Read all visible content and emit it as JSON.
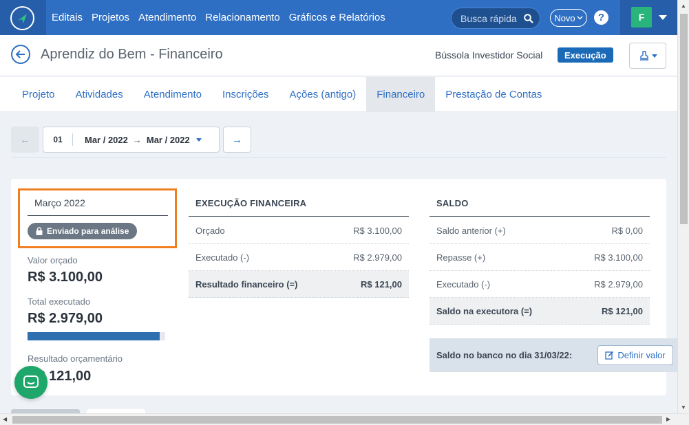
{
  "nav": {
    "items": [
      "Editais",
      "Projetos",
      "Atendimento",
      "Relacionamento",
      "Gráficos e Relatórios"
    ],
    "search_placeholder": "Busca rápida",
    "novo_label": "Novo",
    "help_label": "?",
    "avatar_initial": "F"
  },
  "header": {
    "title": "Aprendiz do Bem - Financeiro",
    "organization": "Bússola Investidor Social",
    "status_badge": "Execução"
  },
  "tabs": [
    {
      "label": "Projeto",
      "active": false
    },
    {
      "label": "Atividades",
      "active": false
    },
    {
      "label": "Atendimento",
      "active": false
    },
    {
      "label": "Inscrições",
      "active": false
    },
    {
      "label": "Ações (antigo)",
      "active": false
    },
    {
      "label": "Financeiro",
      "active": true
    },
    {
      "label": "Prestação de Contas",
      "active": false
    }
  ],
  "period": {
    "number": "01",
    "from": "Mar / 2022",
    "to": "Mar / 2022"
  },
  "summary": {
    "month": "Março 2022",
    "status": "Enviado para análise",
    "budget_label": "Valor orçado",
    "budget_value": "R$ 3.100,00",
    "executed_label": "Total executado",
    "executed_value": "R$ 2.979,00",
    "executed_progress": 0.961,
    "result_label": "Resultado orçamentário",
    "result_value": "R$ 121,00"
  },
  "execucao": {
    "title": "EXECUÇÃO FINANCEIRA",
    "rows": [
      {
        "label": "Orçado",
        "value": "R$ 3.100,00"
      },
      {
        "label": "Executado (-)",
        "value": "R$ 2.979,00"
      }
    ],
    "total": {
      "label": "Resultado financeiro (=)",
      "value": "R$ 121,00"
    }
  },
  "saldo": {
    "title": "SALDO",
    "rows": [
      {
        "label": "Saldo anterior (+)",
        "value": "R$ 0,00"
      },
      {
        "label": "Repasse (+)",
        "value": "R$ 3.100,00"
      },
      {
        "label": "Executado (-)",
        "value": "R$ 2.979,00"
      }
    ],
    "total": {
      "label": "Saldo na executora (=)",
      "value": "R$ 121,00"
    },
    "bank_label": "Saldo no banco no dia 31/03/22:",
    "define_button": "Definir valor"
  }
}
